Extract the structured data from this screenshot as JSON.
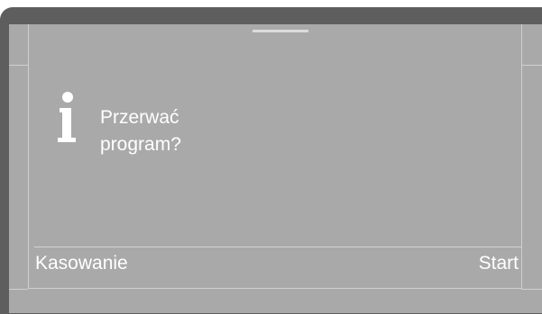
{
  "dialog": {
    "message_line1": "Przerwać",
    "message_line2": "program?",
    "icon": "info-icon"
  },
  "softkeys": {
    "left_label": "Kasowanie",
    "right_label": "Start"
  },
  "colors": {
    "frame": "#5e5e5e",
    "screen": "#a9a9a9",
    "text": "#ffffff"
  }
}
